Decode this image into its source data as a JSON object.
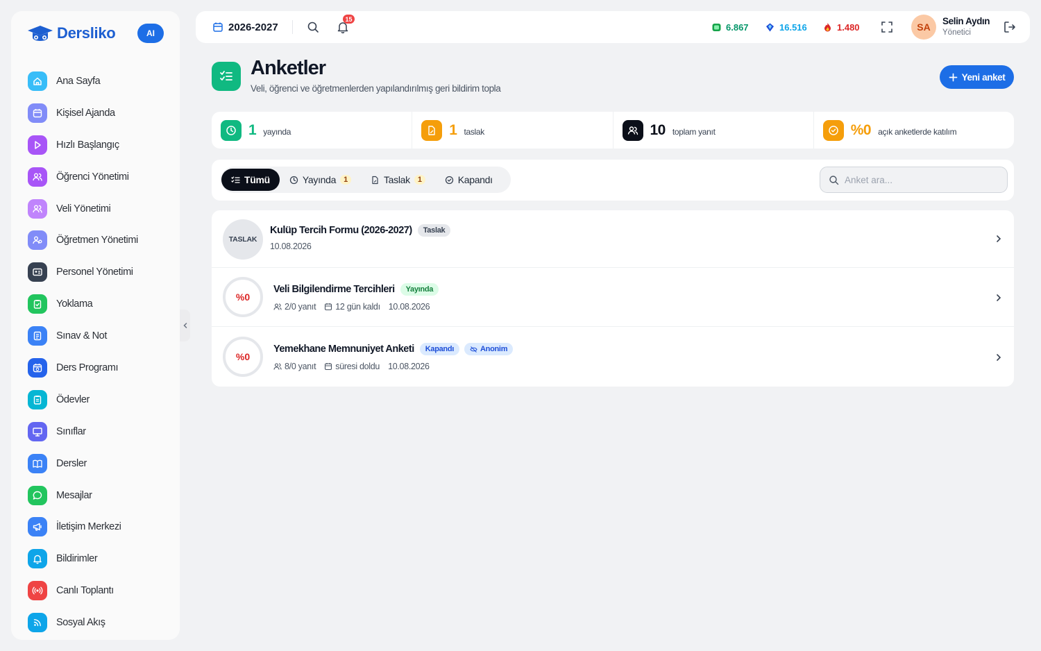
{
  "brand": {
    "name": "Dersliko",
    "ai_label": "AI"
  },
  "sidebar": {
    "items": [
      {
        "label": "Ana Sayfa",
        "icon": "home-icon",
        "color": "#38bdf8"
      },
      {
        "label": "Kişisel Ajanda",
        "icon": "calendar-icon",
        "color": "#818cf8"
      },
      {
        "label": "Hızlı Başlangıç",
        "icon": "play-icon",
        "color": "#a855f7"
      },
      {
        "label": "Öğrenci Yönetimi",
        "icon": "users-icon",
        "color": "#a855f7"
      },
      {
        "label": "Veli Yönetimi",
        "icon": "users-icon",
        "color": "#c084fc"
      },
      {
        "label": "Öğretmen Yönetimi",
        "icon": "teacher-icon",
        "color": "#818cf8"
      },
      {
        "label": "Personel Yönetimi",
        "icon": "id-card-icon",
        "color": "#374151"
      },
      {
        "label": "Yoklama",
        "icon": "clipboard-check-icon",
        "color": "#22c55e"
      },
      {
        "label": "Sınav & Not",
        "icon": "exam-icon",
        "color": "#3b82f6"
      },
      {
        "label": "Ders Programı",
        "icon": "calendar-clock-icon",
        "color": "#2563eb"
      },
      {
        "label": "Ödevler",
        "icon": "clipboard-list-icon",
        "color": "#06b6d4"
      },
      {
        "label": "Sınıflar",
        "icon": "presentation-icon",
        "color": "#6366f1"
      },
      {
        "label": "Dersler",
        "icon": "book-open-icon",
        "color": "#3b82f6"
      },
      {
        "label": "Mesajlar",
        "icon": "message-icon",
        "color": "#22c55e"
      },
      {
        "label": "İletişim Merkezi",
        "icon": "megaphone-icon",
        "color": "#3b82f6"
      },
      {
        "label": "Bildirimler",
        "icon": "bell-icon",
        "color": "#0ea5e9"
      },
      {
        "label": "Canlı Toplantı",
        "icon": "broadcast-icon",
        "color": "#ef4444"
      },
      {
        "label": "Sosyal Akış",
        "icon": "rss-icon",
        "color": "#0ea5e9"
      }
    ]
  },
  "topbar": {
    "year": "2026-2027",
    "notification_count": "15",
    "stats": [
      {
        "value": "6.867",
        "icon": "green-gem-icon",
        "color": "#059669"
      },
      {
        "value": "16.516",
        "icon": "blue-gem-icon",
        "color": "#0ea5e9"
      },
      {
        "value": "1.480",
        "icon": "fire-icon",
        "color": "#dc2626"
      }
    ],
    "user": {
      "initials": "SA",
      "name": "Selin Aydın",
      "role": "Yönetici"
    }
  },
  "header": {
    "title": "Anketler",
    "subtitle": "Veli, öğrenci ve öğretmenlerden yapılandırılmış geri bildirim topla",
    "new_button": "Yeni anket"
  },
  "stats": [
    {
      "value": "1",
      "label": "yayında",
      "color": "#10b981",
      "icon": "clock-icon"
    },
    {
      "value": "1",
      "label": "taslak",
      "color": "#f59e0b",
      "icon": "file-edit-icon"
    },
    {
      "value": "10",
      "label": "toplam yanıt",
      "color": "#0b0f19",
      "icon": "users-icon"
    },
    {
      "value": "%0",
      "label": "açık anketlerde katılım",
      "color": "#f59e0b",
      "icon": "check-circle-icon"
    }
  ],
  "filters": {
    "tabs": [
      {
        "label": "Tümü",
        "count": ""
      },
      {
        "label": "Yayında",
        "count": "1"
      },
      {
        "label": "Taslak",
        "count": "1"
      },
      {
        "label": "Kapandı",
        "count": ""
      }
    ],
    "search_placeholder": "Anket ara..."
  },
  "surveys": [
    {
      "ring": "TASLAK",
      "title": "Kulüp Tercih Formu (2026-2027)",
      "badges": [
        "Taslak"
      ],
      "responses": "",
      "time": "",
      "date": "10.08.2026"
    },
    {
      "ring": "%0",
      "title": "Veli Bilgilendirme Tercihleri",
      "badges": [
        "Yayında"
      ],
      "responses": "2/0 yanıt",
      "time": "12 gün kaldı",
      "date": "10.08.2026"
    },
    {
      "ring": "%0",
      "title": "Yemekhane Memnuniyet Anketi",
      "badges": [
        "Kapandı",
        "Anonim"
      ],
      "responses": "8/0 yanıt",
      "time": "süresi doldu",
      "date": "10.08.2026"
    }
  ]
}
